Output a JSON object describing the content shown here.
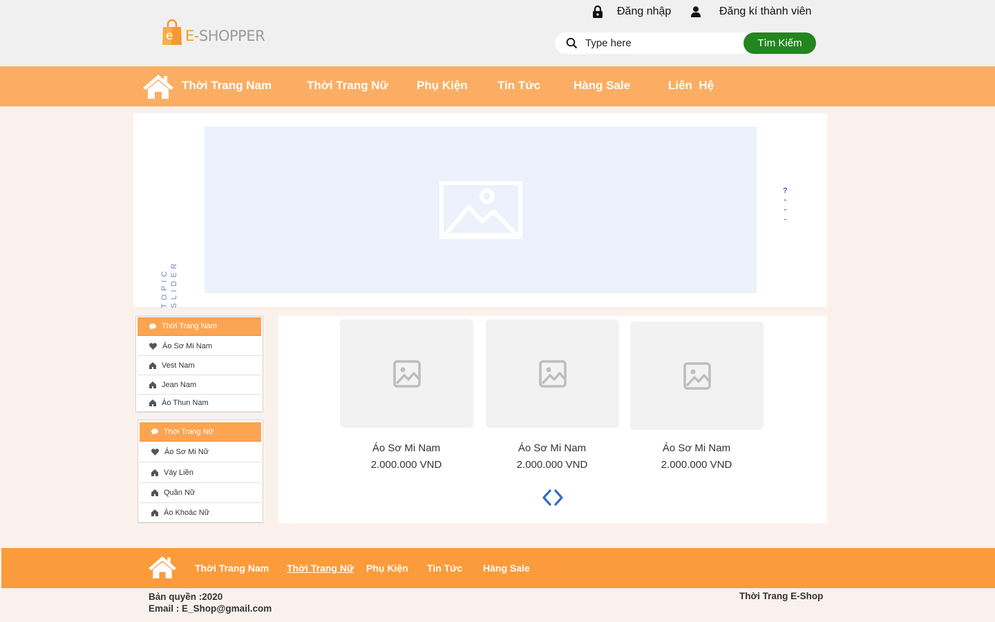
{
  "header": {
    "logo": {
      "letter": "e",
      "text_main": "E-",
      "text_rest": "SHOPPER"
    },
    "login_label": "Đăng nhập",
    "register_label": "Đăng kí thành viên",
    "search": {
      "placeholder": "Type here",
      "button_label": "Tìm Kiếm"
    }
  },
  "nav": {
    "items": [
      {
        "label": "Thời Trang Nam"
      },
      {
        "label": "Thời Trang Nữ"
      },
      {
        "label": "Phụ Kiện"
      },
      {
        "label": "Tin Tức"
      },
      {
        "label": "Hàng Sale"
      },
      {
        "label": "Liên  Hệ"
      }
    ]
  },
  "slider": {
    "topic_line1": "TOPIC",
    "topic_line2": "SLIDER",
    "dot_glyph": "?"
  },
  "categories": [
    {
      "title": "Thời Trang Nam",
      "items": [
        {
          "label": "Áo Sơ Mi Nam",
          "icon": "heart-icon"
        },
        {
          "label": "Vest Nam",
          "icon": "home-icon"
        },
        {
          "label": "Jean Nam",
          "icon": "home-icon"
        },
        {
          "label": "Áo Thun Nam",
          "icon": "home-icon"
        }
      ]
    },
    {
      "title": "Thời Trang Nữ",
      "items": [
        {
          "label": "Áo Sơ Mi Nữ",
          "icon": "heart-icon"
        },
        {
          "label": "Váy Liền",
          "icon": "home-icon"
        },
        {
          "label": "Quần Nữ",
          "icon": "home-icon"
        },
        {
          "label": "Áo Khoác Nữ",
          "icon": "home-icon"
        }
      ]
    }
  ],
  "products": [
    {
      "name": "Áo Sơ Mi Nam",
      "price": "2.000.000 VND"
    },
    {
      "name": "Áo Sơ Mi Nam",
      "price": "2.000.000 VND"
    },
    {
      "name": "Áo Sơ Mi Nam",
      "price": "2.000.000 VND"
    }
  ],
  "footer": {
    "items": [
      {
        "label": "Thời Trang Nam"
      },
      {
        "label": "Thời Trang Nữ"
      },
      {
        "label": "Phụ Kiện"
      },
      {
        "label": "Tin Tức"
      },
      {
        "label": "Hàng Sale"
      }
    ],
    "copyright": "Bản quyền :2020",
    "email": "Email : E_Shop@gmail.com",
    "brand": "Thời Trang E-Shop"
  },
  "colors": {
    "nav_bg": "#fbad63",
    "footer_bg": "#fb9b3b",
    "search_button": "#23861f",
    "category_header": "#fba552",
    "arrow": "#2f6fc7"
  }
}
